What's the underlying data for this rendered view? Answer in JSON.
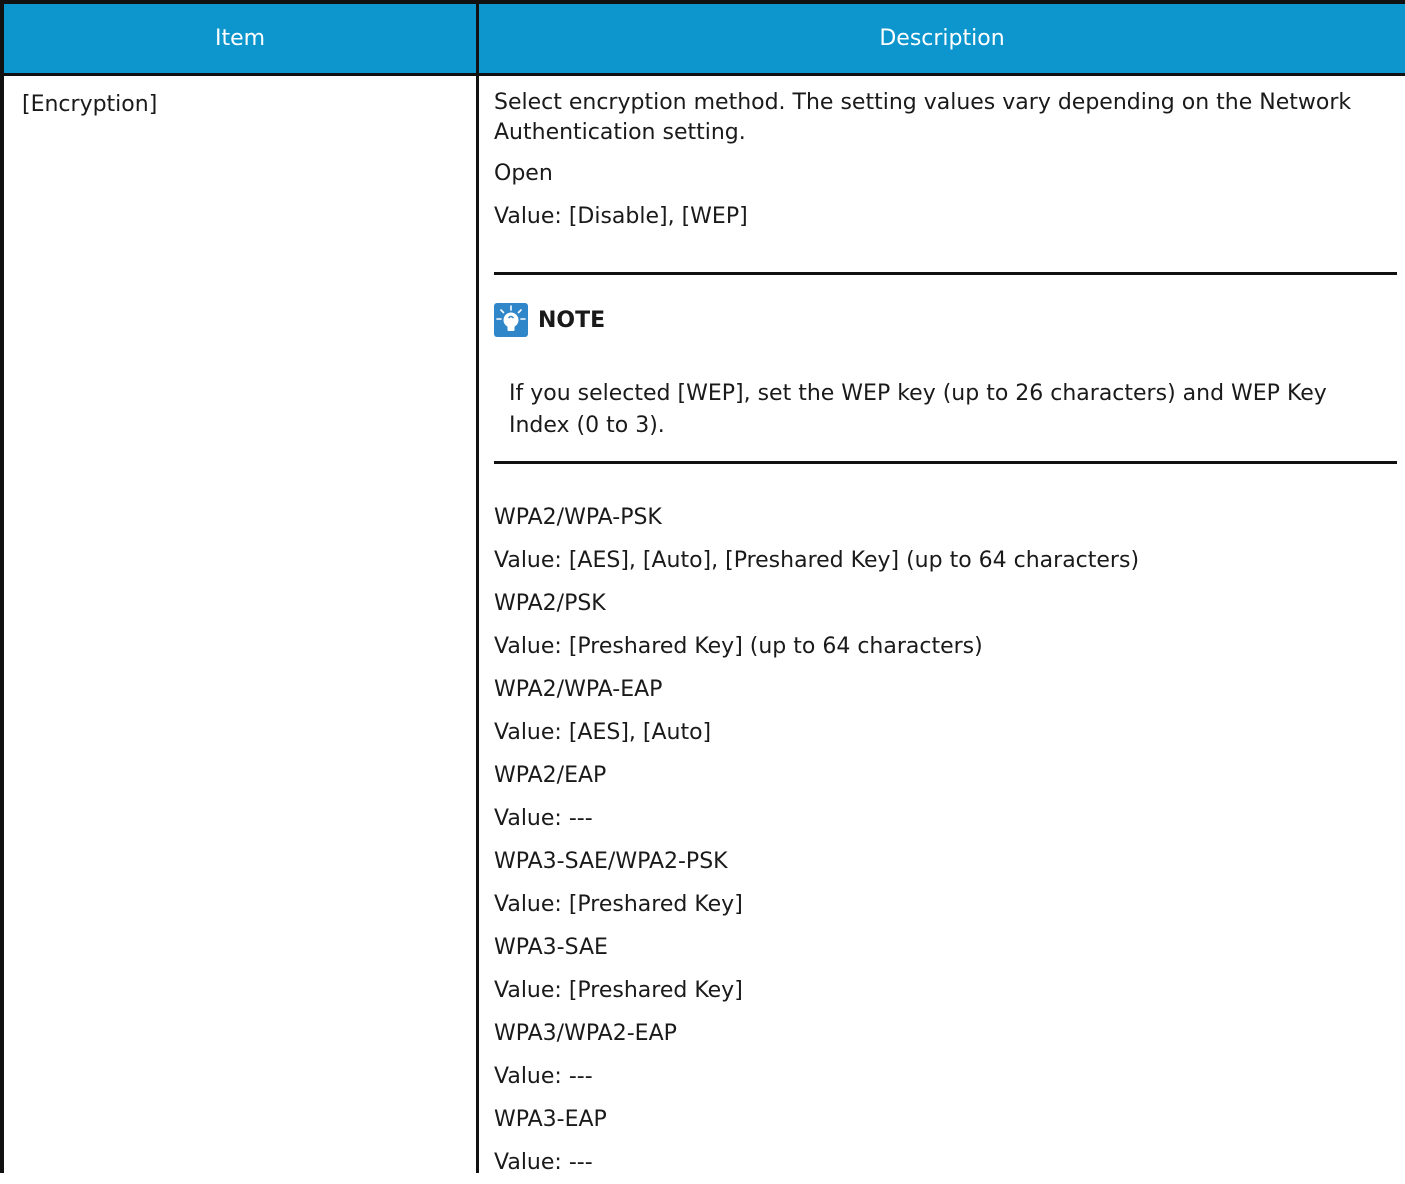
{
  "table": {
    "headers": {
      "item": "Item",
      "description": "Description"
    },
    "row": {
      "item": "[Encryption]",
      "intro": "Select encryption method. The setting values vary depending on the Network Authentication setting.",
      "open_label": "Open",
      "open_value": "Value: [Disable], [WEP]",
      "note": {
        "title": "NOTE",
        "icon": "lightbulb-note-icon",
        "text": "If you selected [WEP], set the WEP key (up to 26 characters) and WEP Key Index (0 to 3)."
      },
      "options": [
        {
          "label": "WPA2/WPA-PSK",
          "value": "Value: [AES], [Auto], [Preshared Key] (up to 64 characters)"
        },
        {
          "label": "WPA2/PSK",
          "value": "Value: [Preshared Key] (up to 64 characters)"
        },
        {
          "label": "WPA2/WPA-EAP",
          "value": "Value: [AES], [Auto]"
        },
        {
          "label": "WPA2/EAP",
          "value": "Value: ---"
        },
        {
          "label": "WPA3-SAE/WPA2-PSK",
          "value": "Value: [Preshared Key]"
        },
        {
          "label": "WPA3-SAE",
          "value": "Value: [Preshared Key]"
        },
        {
          "label": "WPA3/WPA2-EAP",
          "value": "Value: ---"
        },
        {
          "label": "WPA3-EAP",
          "value": "Value: ---"
        }
      ]
    }
  },
  "colors": {
    "header_bg": "#0c96cd",
    "header_text": "#ffffff",
    "border": "#111111"
  }
}
